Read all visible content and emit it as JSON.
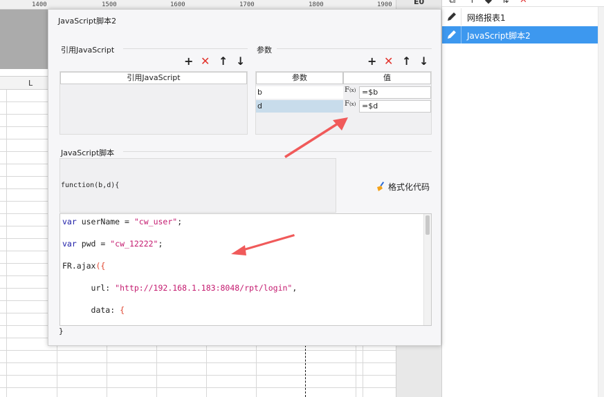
{
  "ruler": {
    "marks": [
      "1400",
      "1500",
      "1600",
      "1700",
      "1800",
      "1900"
    ]
  },
  "spreadsheet": {
    "column_label": "L"
  },
  "right_panel": {
    "items": [
      {
        "label": "网络报表1",
        "selected": false
      },
      {
        "label": "JavaScript脚本2",
        "selected": true
      }
    ],
    "selected_color": "#3d98ef"
  },
  "dialog": {
    "title": "JavaScript脚本2",
    "ref_js": {
      "section_title": "引用JavaScript",
      "column_header": "引用JavaScript"
    },
    "params": {
      "section_title": "参数",
      "headers": {
        "param": "参数",
        "value": "值"
      },
      "rows": [
        {
          "name": "b",
          "fx": "F(x)",
          "value": "=$b",
          "selected": false
        },
        {
          "name": "d",
          "fx": "F(x)",
          "value": "=$d",
          "selected": true
        }
      ]
    },
    "script": {
      "section_title": "JavaScript脚本",
      "signature": "function(b,d){",
      "format_button": "格式化代码",
      "closing": "}"
    }
  },
  "icons": {
    "toolbar": [
      "add-icon",
      "delete-icon",
      "move-up-icon",
      "move-down-icon"
    ],
    "format": "broom-icon",
    "item": "edit-pencil-icon"
  },
  "colors": {
    "keyword": "#1a1aa6",
    "string": "#c41a6f",
    "annotation_arrow": "#f05a5a",
    "delete": "#e2322b"
  }
}
